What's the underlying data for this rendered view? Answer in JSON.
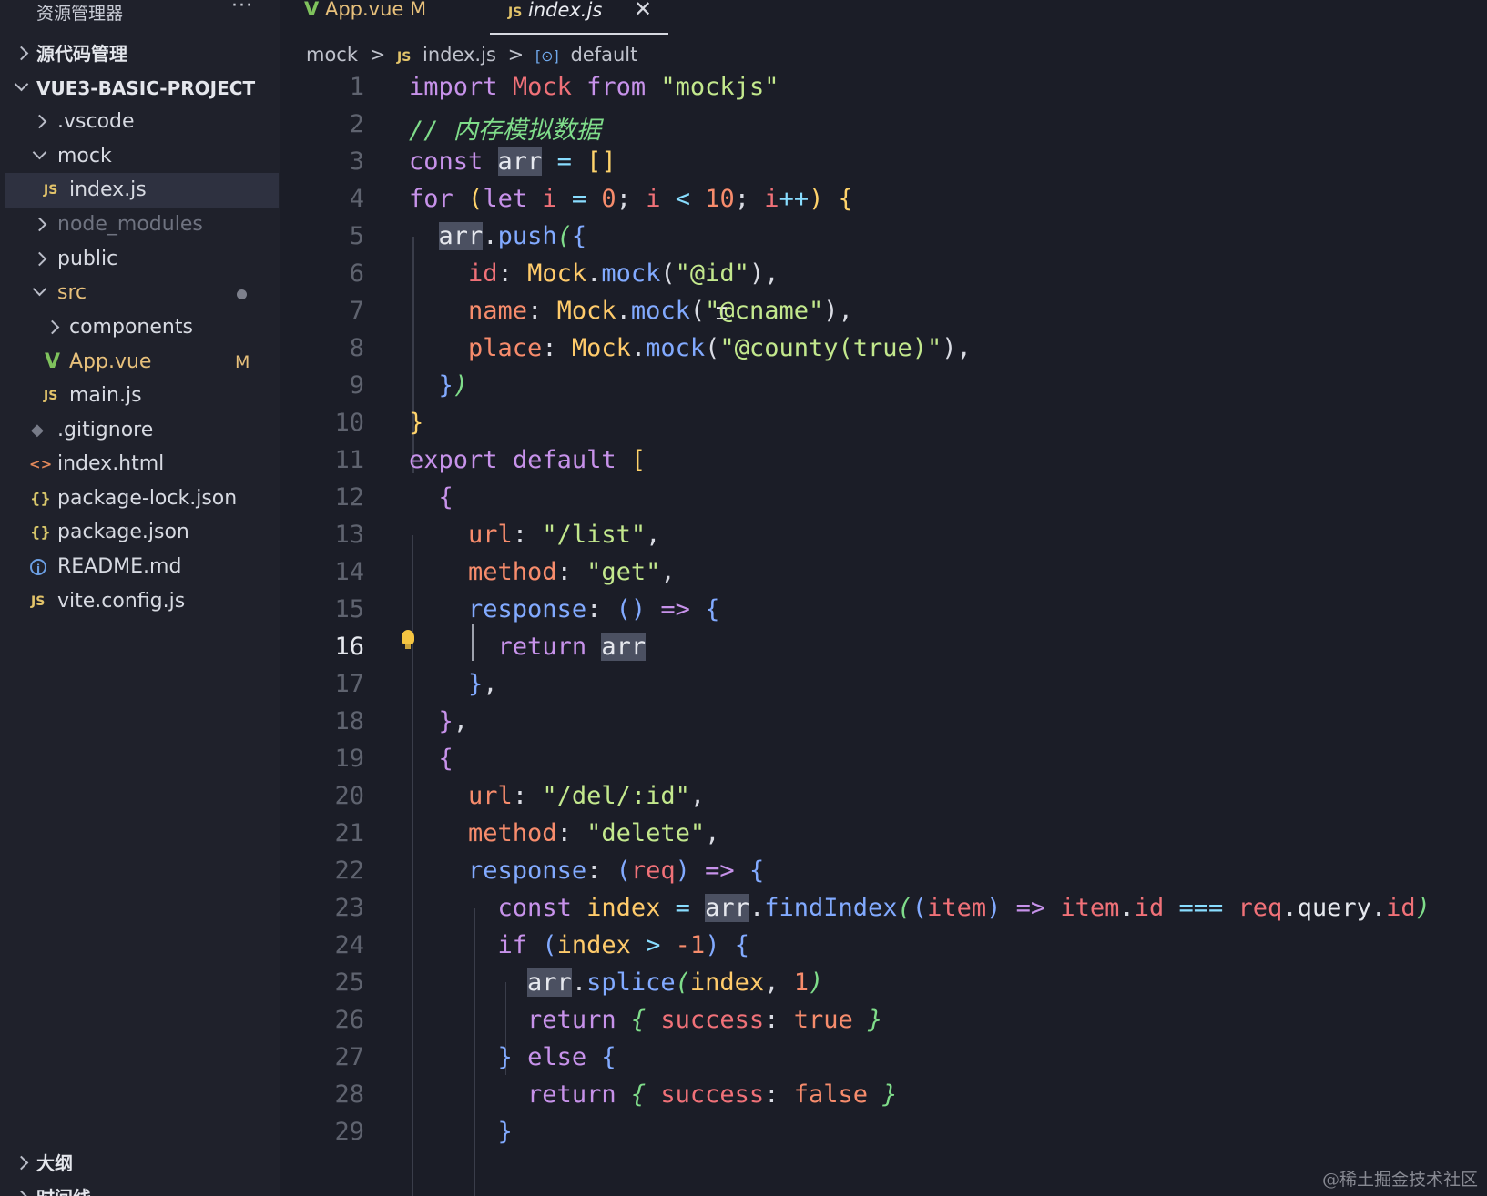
{
  "sidebar": {
    "title": "资源管理器",
    "more": "···",
    "sections": {
      "source_control": "源代码管理",
      "project": "VUE3-BASIC-PROJECT",
      "outline": "大纲",
      "timeline": "时间线"
    },
    "files": {
      "vscode": ".vscode",
      "mock": "mock",
      "mock_index": "index.js",
      "node_modules": "node_modules",
      "public": "public",
      "src": "src",
      "components": "components",
      "app_vue": "App.vue",
      "app_vue_badge": "M",
      "main_js": "main.js",
      "gitignore": ".gitignore",
      "index_html": "index.html",
      "package_lock": "package-lock.json",
      "package_json": "package.json",
      "readme": "README.md",
      "vite_config": "vite.config.js"
    },
    "icons": {
      "js": "JS",
      "vue": "V",
      "json": "{}",
      "html": "<>",
      "git": "◆",
      "info": "i"
    }
  },
  "tabs": [
    {
      "label": "App.vue",
      "badge": "M",
      "icon": "V"
    },
    {
      "label": "index.js",
      "icon": "JS",
      "close": "✕"
    }
  ],
  "breadcrumb": {
    "folder": "mock",
    "sep": ">",
    "file_icon": "JS",
    "file": "index.js",
    "symbol_icon": "[⊙]",
    "symbol": "default"
  },
  "editor": {
    "active_line": 16,
    "line_numbers": [
      "1",
      "2",
      "3",
      "4",
      "5",
      "6",
      "7",
      "8",
      "9",
      "10",
      "11",
      "12",
      "13",
      "14",
      "15",
      "16",
      "17",
      "18",
      "19",
      "20",
      "21",
      "22",
      "23",
      "24",
      "25",
      "26",
      "27",
      "28",
      "29"
    ]
  },
  "watermark": "@稀土掘金技术社区",
  "colors": {
    "keyword": "#c792ea",
    "variable": "#f07178",
    "string": "#c3e88d",
    "number": "#f78c6c",
    "function": "#82aaff",
    "comment": "#7fdc8a",
    "modified": "#e7c07b"
  }
}
